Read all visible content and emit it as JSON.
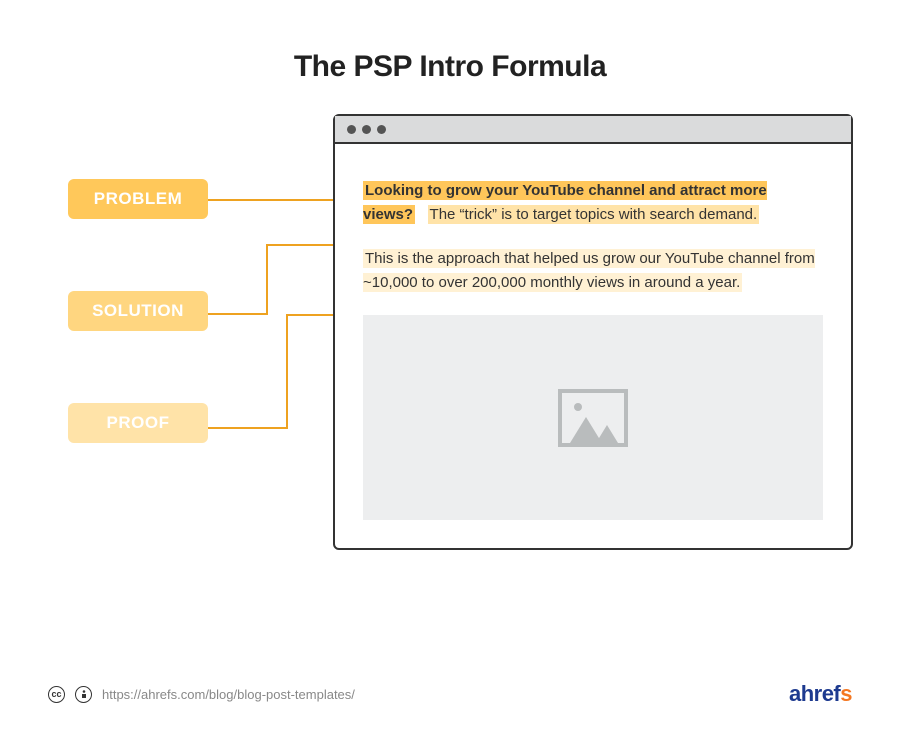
{
  "title": "The PSP Intro Formula",
  "labels": {
    "problem": "PROBLEM",
    "solution": "SOLUTION",
    "proof": "PROOF"
  },
  "content": {
    "problem_text": "Looking to grow your YouTube channel and attract more views?",
    "solution_text": "The “trick” is to target topics with search demand.",
    "proof_text": "This is the approach that helped us grow our YouTube channel from ~10,000 to over 200,000 monthly views in around a year."
  },
  "footer": {
    "url": "https://ahrefs.com/blog/blog-post-templates/",
    "brand_a": "ahref",
    "brand_s": "s"
  },
  "colors": {
    "label_problem": "#FFC85A",
    "label_solution": "#FFD680",
    "label_proof": "#FFE3A8",
    "connector": "#EEA220",
    "brand_blue": "#1D3A8F",
    "brand_orange": "#F47721"
  }
}
